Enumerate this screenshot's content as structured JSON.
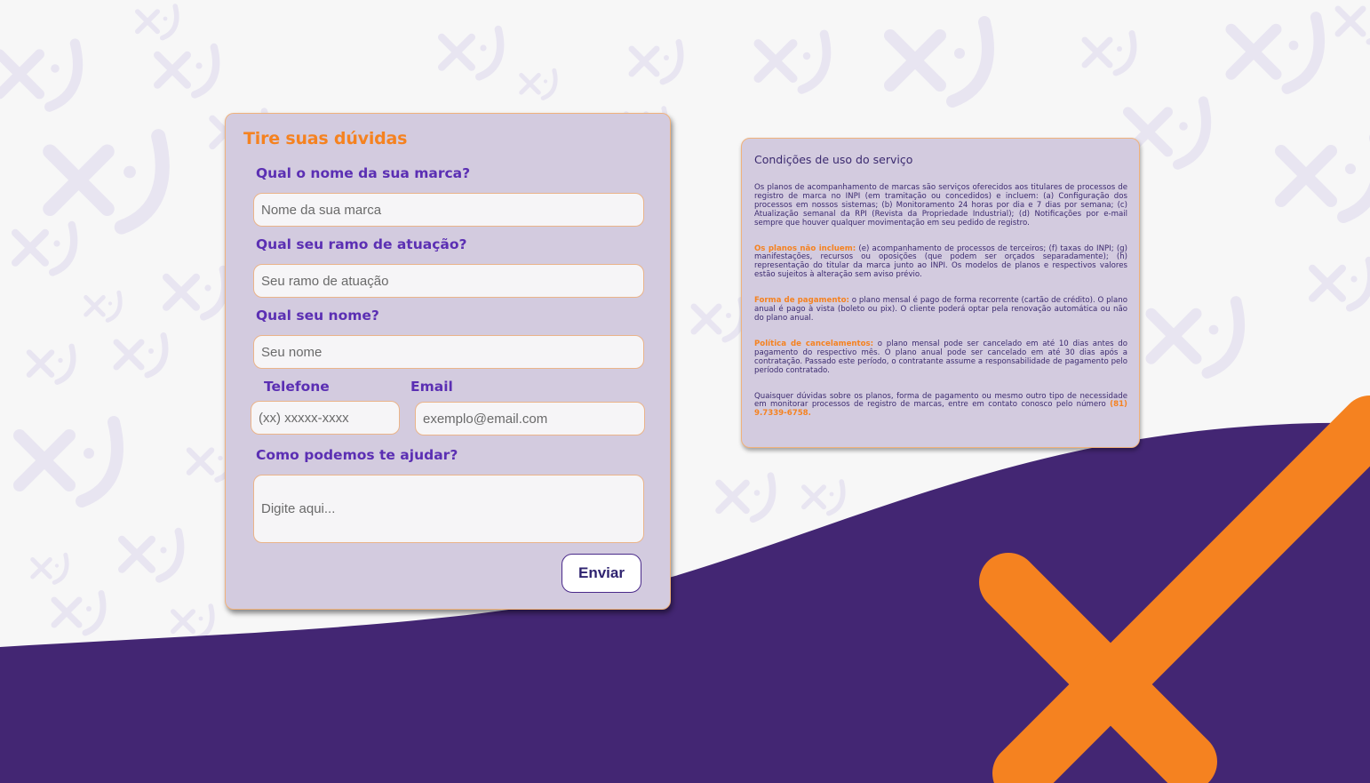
{
  "colors": {
    "brand_purple": "#432673",
    "brand_orange": "#f58220",
    "label_purple": "#5b2fb3",
    "card_bg": "#d3cbdf"
  },
  "background": {
    "pattern_icon": "x-smile-icon",
    "large_mark_icon": "orange-x-icon"
  },
  "form": {
    "title": "Tire suas dúvidas",
    "brand_label": "Qual o nome da sua marca?",
    "brand_placeholder": "Nome da sua marca",
    "sector_label": "Qual seu ramo de atuação?",
    "sector_placeholder": "Seu ramo de atuação",
    "name_label": "Qual seu nome?",
    "name_placeholder": "Seu nome",
    "phone_label": "Telefone",
    "phone_placeholder": "(xx) xxxxx-xxxx",
    "email_label": "Email",
    "email_placeholder": "exemplo@email.com",
    "message_label": "Como podemos te ajudar?",
    "message_placeholder": "Digite aqui...",
    "submit_label": "Enviar"
  },
  "terms": {
    "title": "Condições de uso do serviço",
    "p1": "Os planos de acompanhamento de marcas são serviços oferecidos aos titulares de processos de registro de marca no INPI (em tramitação ou concedidos) e incluem: (a) Configuração dos processos em nossos sistemas; (b) Monitoramento 24 horas por dia e 7 dias por semana; (c) Atualização semanal da RPI (Revista da Propriedade Industrial); (d) Notificações por e-mail sempre que houver qualquer movimentação em seu pedido de registro.",
    "p2_highlight": "Os planos não incluem:",
    "p2_text": " (e) acompanhamento de processos de terceiros; (f) taxas do INPI; (g) manifestações, recursos ou oposições (que podem ser orçados separadamente); (h) representação do titular da marca junto ao INPI. Os modelos de planos e respectivos valores estão sujeitos à alteração sem aviso prévio.",
    "p3_highlight": "Forma de pagamento:",
    "p3_text": " o plano mensal é pago de forma recorrente (cartão de crédito). O plano anual é pago à vista (boleto ou pix). O cliente poderá optar pela renovação automática ou não do plano anual.",
    "p4_highlight": "Política de cancelamentos:",
    "p4_text": " o plano mensal pode ser cancelado em até 10 dias antes do pagamento do respectivo mês. O plano anual pode ser cancelado em até 30 dias após a contratação. Passado este período, o contratante assume a responsabilidade de pagamento pelo período contratado.",
    "p5_text": "Quaisquer dúvidas sobre os planos, forma de pagamento ou mesmo outro tipo de necessidade em monitorar processos de registro de marcas, entre em contato conosco pelo número ",
    "p5_phone": "(81) 9.7339-6758."
  }
}
